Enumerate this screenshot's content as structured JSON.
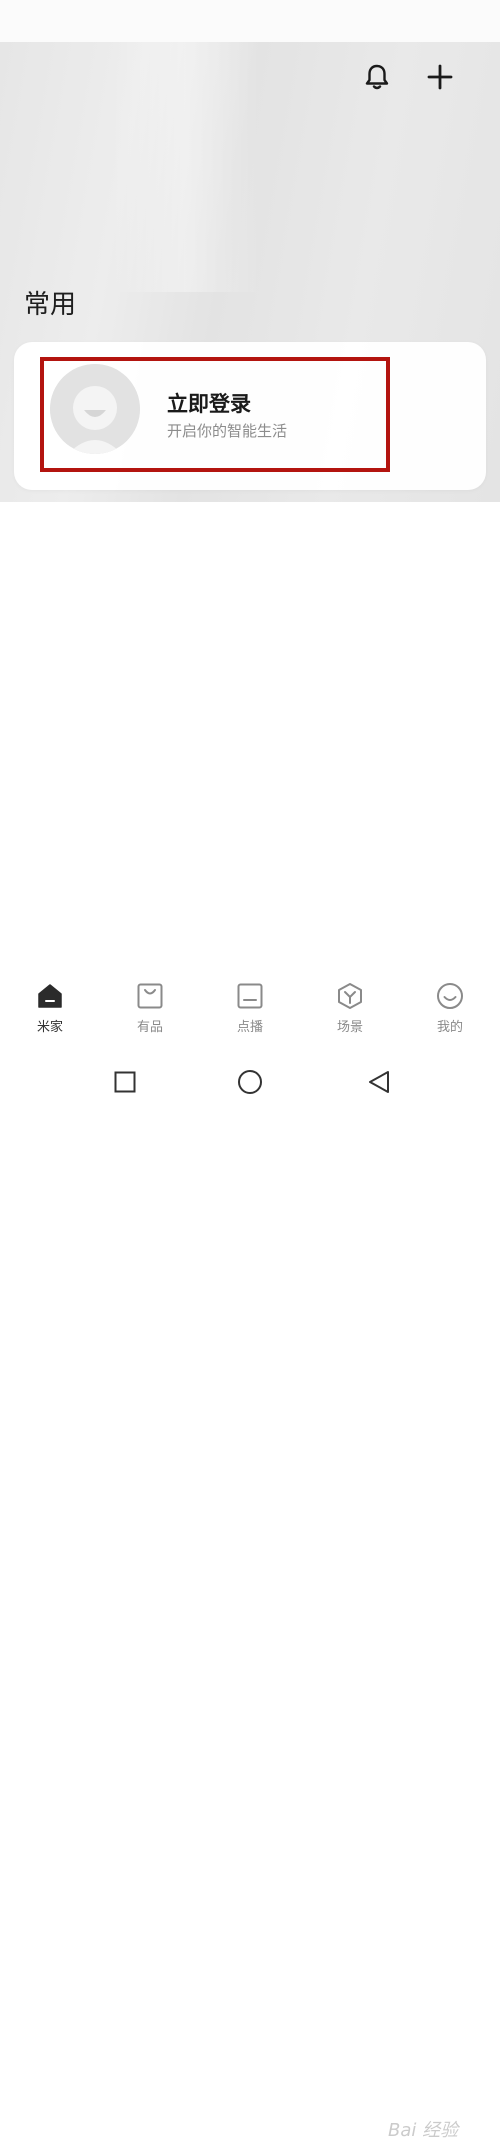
{
  "header": {
    "bell_icon": "bell-icon",
    "add_icon": "plus-icon"
  },
  "section": {
    "title": "常用"
  },
  "login_card": {
    "title": "立即登录",
    "subtitle": "开启你的智能生活",
    "avatar_icon": "default-avatar-icon",
    "highlight_color": "#b3140f"
  },
  "bottom_nav": {
    "items": [
      {
        "label": "米家",
        "icon": "home-icon",
        "active": true
      },
      {
        "label": "有品",
        "icon": "shopping-bag-icon",
        "active": false
      },
      {
        "label": "点播",
        "icon": "tv-icon",
        "active": false
      },
      {
        "label": "场景",
        "icon": "cube-icon",
        "active": false
      },
      {
        "label": "我的",
        "icon": "smiley-icon",
        "active": false
      }
    ]
  },
  "system_nav": {
    "recent_icon": "square-icon",
    "home_icon": "circle-icon",
    "back_icon": "back-triangle-icon"
  },
  "watermark": "Bai 经验",
  "colors": {
    "active": "#333333",
    "inactive": "#8a8a8a",
    "subtitle": "#8c8c8c"
  }
}
